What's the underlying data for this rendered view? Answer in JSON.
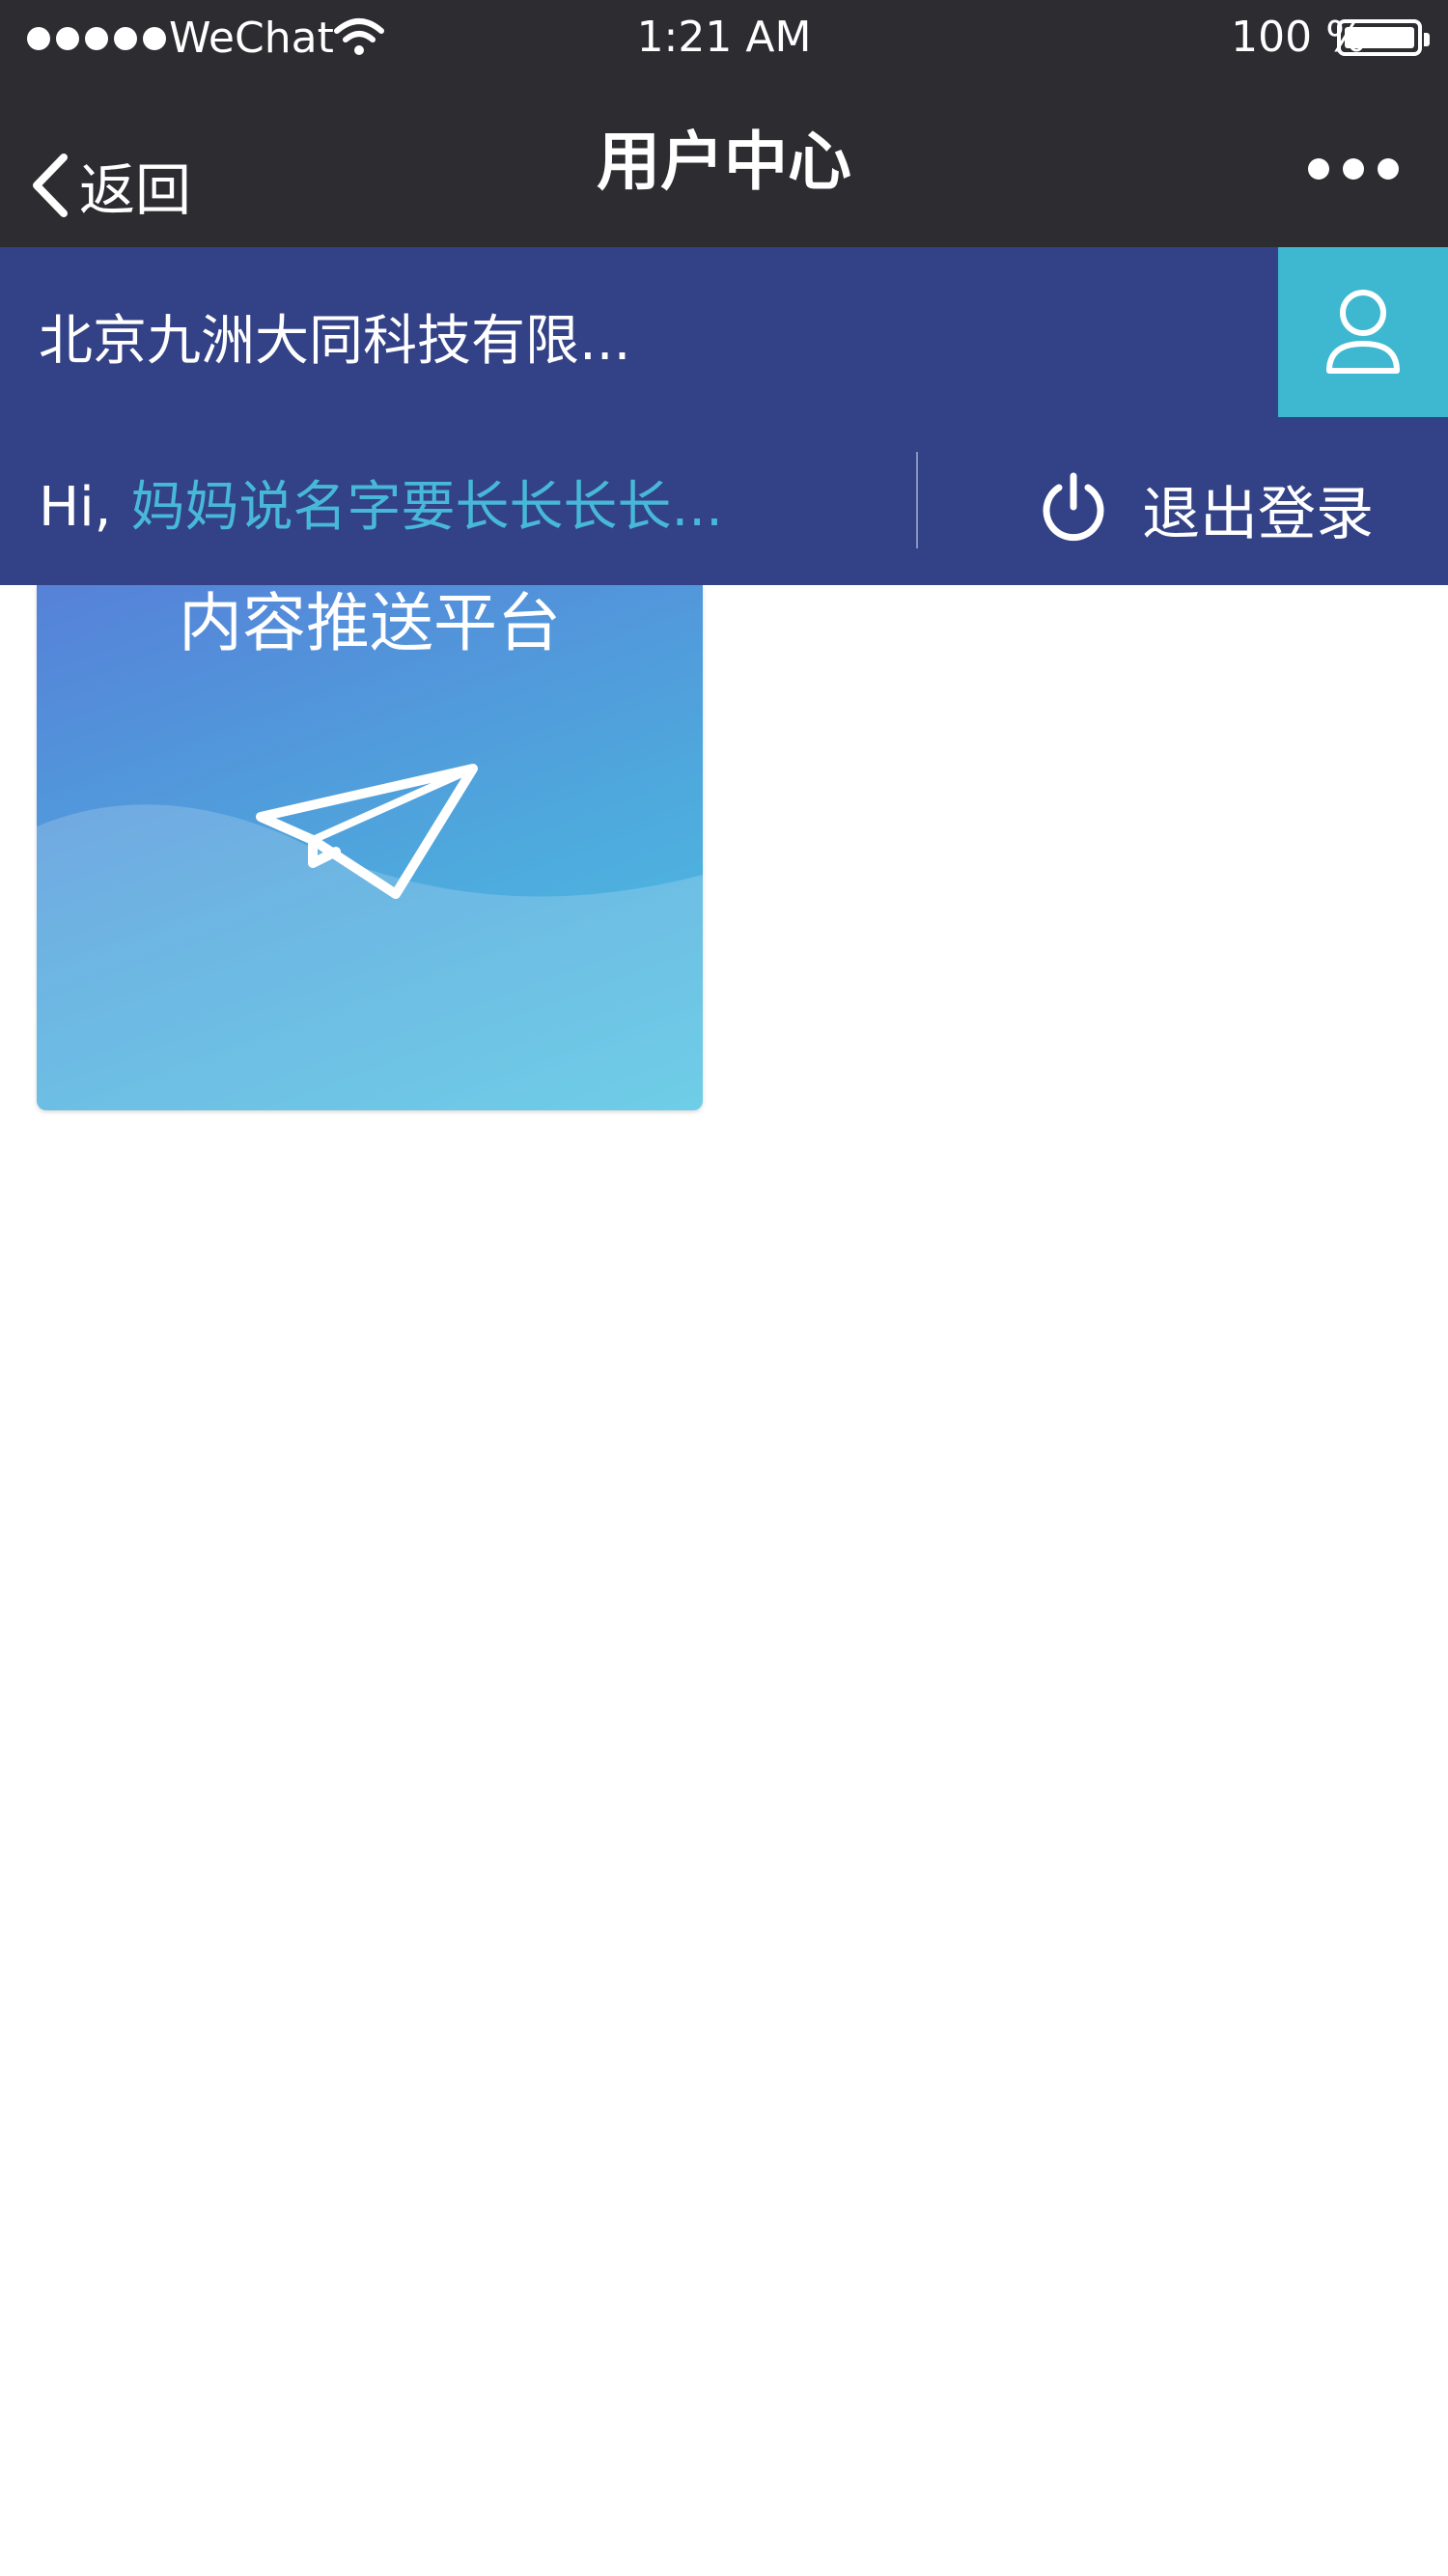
{
  "status_bar": {
    "carrier": "WeChat",
    "time": "1:21 AM",
    "battery": "100 %"
  },
  "nav": {
    "back_label": "返回",
    "title": "用户中心"
  },
  "header": {
    "company": "北京九洲大同科技有限...",
    "greeting": "Hi,",
    "username": "妈妈说名字要长长长长...",
    "logout_label": "退出登录"
  },
  "card": {
    "title": "内容推送平台"
  },
  "colors": {
    "header_bg": "#334186",
    "avatar_bg": "#3db8d0",
    "username": "#48b8d8",
    "bar_bg": "#2c2c31"
  },
  "icons": [
    "signal-dots",
    "wifi-icon",
    "battery-icon",
    "back-chevron-icon",
    "more-icon",
    "user-icon",
    "power-icon",
    "paper-plane-icon"
  ]
}
